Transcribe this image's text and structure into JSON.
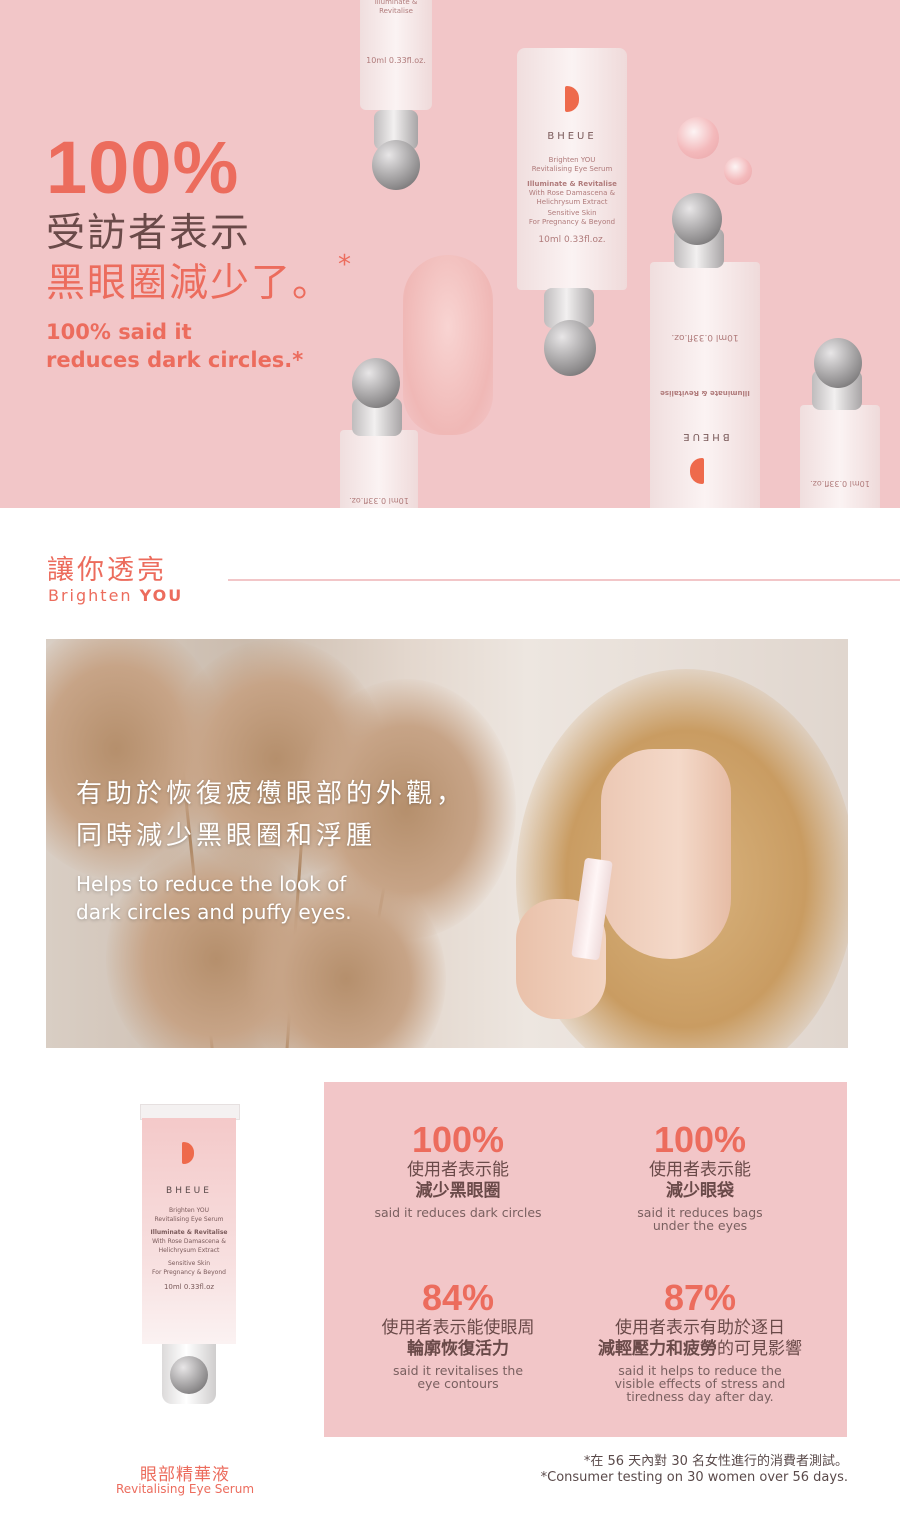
{
  "hero": {
    "stat": "100%",
    "zh_line1": "受訪者表示",
    "zh_line2": "黑眼圈減少了。",
    "asterisk": "*",
    "en_line1": "100% said it",
    "en_line2": "reduces dark circles.*",
    "tube_brand": "BHEUE",
    "tube_text": [
      "Brighten YOU",
      "Revitalising Eye Serum",
      "Illuminate & Revitalise",
      "With Rose Damascena &",
      "Helichrysum Extract",
      "Sensitive Skin",
      "For Pregnancy & Beyond",
      "10ml 0.33fl.oz."
    ]
  },
  "section": {
    "title_zh": "讓你透亮",
    "title_en_light": "Brighten",
    "title_en_bold": "YOU"
  },
  "photo": {
    "zh_line1": "有助於恢復疲憊眼部的外觀，",
    "zh_line2": "同時減少黑眼圈和浮腫",
    "en_line1": "Helps to reduce the look of",
    "en_line2": "dark circles and puffy eyes."
  },
  "product": {
    "brand": "BHEUE",
    "name_zh": "眼部精華液",
    "name_en": "Revitalising Eye Serum",
    "volume": "10ml 0.33fl.oz"
  },
  "stats": [
    {
      "value": "100%",
      "zh": "使用者表示能",
      "zh_bold": "減少黑眼圈",
      "en": "said it reduces dark circles"
    },
    {
      "value": "100%",
      "zh": "使用者表示能",
      "zh_bold": "減少眼袋",
      "en": "said it reduces bags under the eyes"
    },
    {
      "value": "84%",
      "zh": "使用者表示能使眼周",
      "zh_bold": "輪廓恢復活力",
      "en": "said it revitalises the eye contours"
    },
    {
      "value": "87%",
      "zh": "使用者表示有助於逐日",
      "zh_bold": "減輕壓力和疲勞",
      "zh_tail": "的可見影響",
      "en": "said it helps to reduce the visible effects of stress and tiredness day after day."
    }
  ],
  "footnote": {
    "zh": "*在 56 天內對 30 名女性進行的消費者測試。",
    "en": "*Consumer testing on 30 women over 56 days."
  },
  "colors": {
    "accent": "#ec6c5d",
    "pink_bg": "#f2c6c8",
    "text_dark": "#6a4a49"
  }
}
